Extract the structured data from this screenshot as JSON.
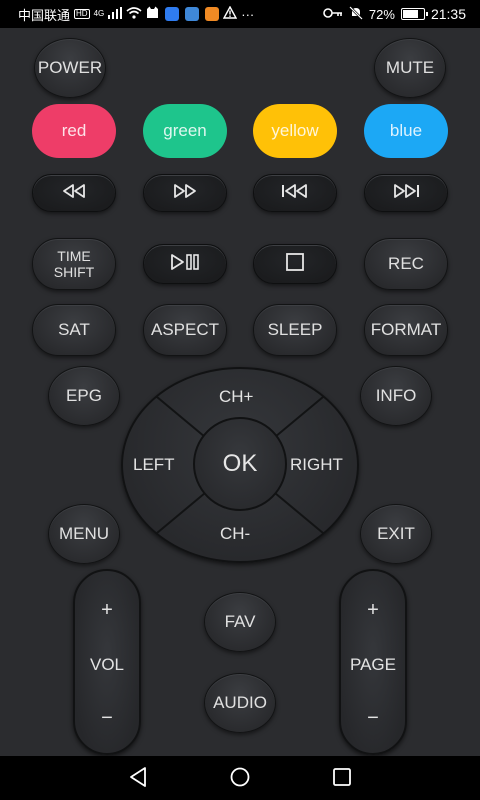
{
  "status_bar": {
    "carrier": "中国联通",
    "hd": "HD",
    "network": "4G",
    "battery": "72%",
    "time": "21:35",
    "more": "···",
    "icons": [
      "signal-icon",
      "wifi-icon",
      "app-icon",
      "warning-icon",
      "key-icon",
      "mute-bell-icon",
      "battery-icon"
    ]
  },
  "remote": {
    "power": "POWER",
    "mute": "MUTE",
    "colors": [
      {
        "label": "red",
        "color": "#ee3d68"
      },
      {
        "label": "green",
        "color": "#1ec58c"
      },
      {
        "label": "yellow",
        "color": "#ffc107"
      },
      {
        "label": "blue",
        "color": "#1ca8f5"
      }
    ],
    "media_icons": [
      "rewind-icon",
      "fast-forward-icon",
      "skip-previous-icon",
      "skip-next-icon",
      "play-pause-icon",
      "stop-icon"
    ],
    "time_shift_line1": "TIME",
    "time_shift_line2": "SHIFT",
    "rec": "REC",
    "sat": "SAT",
    "aspect": "ASPECT",
    "sleep": "SLEEP",
    "format": "FORMAT",
    "epg": "EPG",
    "info": "INFO",
    "menu": "MENU",
    "exit": "EXIT",
    "dpad": {
      "up": "CH+",
      "down": "CH-",
      "left": "LEFT",
      "right": "RIGHT",
      "ok": "OK"
    },
    "vol": {
      "plus": "+",
      "label": "VOL",
      "minus": "−"
    },
    "page": {
      "plus": "+",
      "label": "PAGE",
      "minus": "−"
    },
    "fav": "FAV",
    "audio": "AUDIO"
  },
  "nav_bar": {
    "icons": [
      "back-icon",
      "home-icon",
      "recents-icon"
    ]
  }
}
